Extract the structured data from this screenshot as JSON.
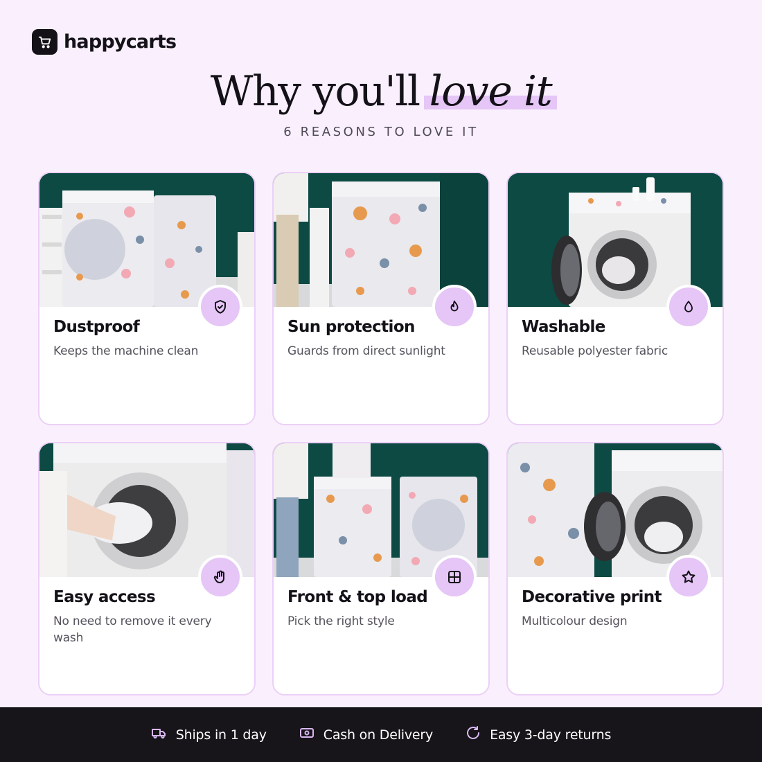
{
  "brand": {
    "name": "happycarts",
    "icon": "cart-icon"
  },
  "heading": {
    "main": "Why you'll",
    "accent": "love it"
  },
  "subheading": "6 REASONS TO LOVE IT",
  "colors": {
    "background": "#faf0fd",
    "accent": "#e5c6f6",
    "dark": "#141218",
    "card_border": "#ecd0f7"
  },
  "cards": [
    {
      "title": "Dustproof",
      "desc": "Keeps the machine clean",
      "icon": "shield-check-icon",
      "photo": "Two printed covers on washing machines"
    },
    {
      "title": "Sun protection",
      "desc": "Guards from direct sunlight",
      "icon": "flame-icon",
      "photo": "Top-load washer with printed cover"
    },
    {
      "title": "Washable",
      "desc": "Reusable polyester fabric",
      "icon": "droplet-icon",
      "photo": "Front-load washer with open door"
    },
    {
      "title": "Easy access",
      "desc": "No need to remove it every wash",
      "icon": "hand-icon",
      "photo": "Hands loading laundry into washer"
    },
    {
      "title": "Front & top load",
      "desc": "Pick the right style",
      "icon": "grid-icon",
      "photo": "Top-load and front-load covers side by side"
    },
    {
      "title": "Decorative print",
      "desc": "Multicolour design",
      "icon": "star-icon",
      "photo": "Printed cover with open washer"
    }
  ],
  "footer": [
    {
      "label": "Ships in 1 day",
      "icon": "truck-icon"
    },
    {
      "label": "Cash on Delivery",
      "icon": "cash-icon"
    },
    {
      "label": "Easy 3-day returns",
      "icon": "return-icon"
    }
  ]
}
